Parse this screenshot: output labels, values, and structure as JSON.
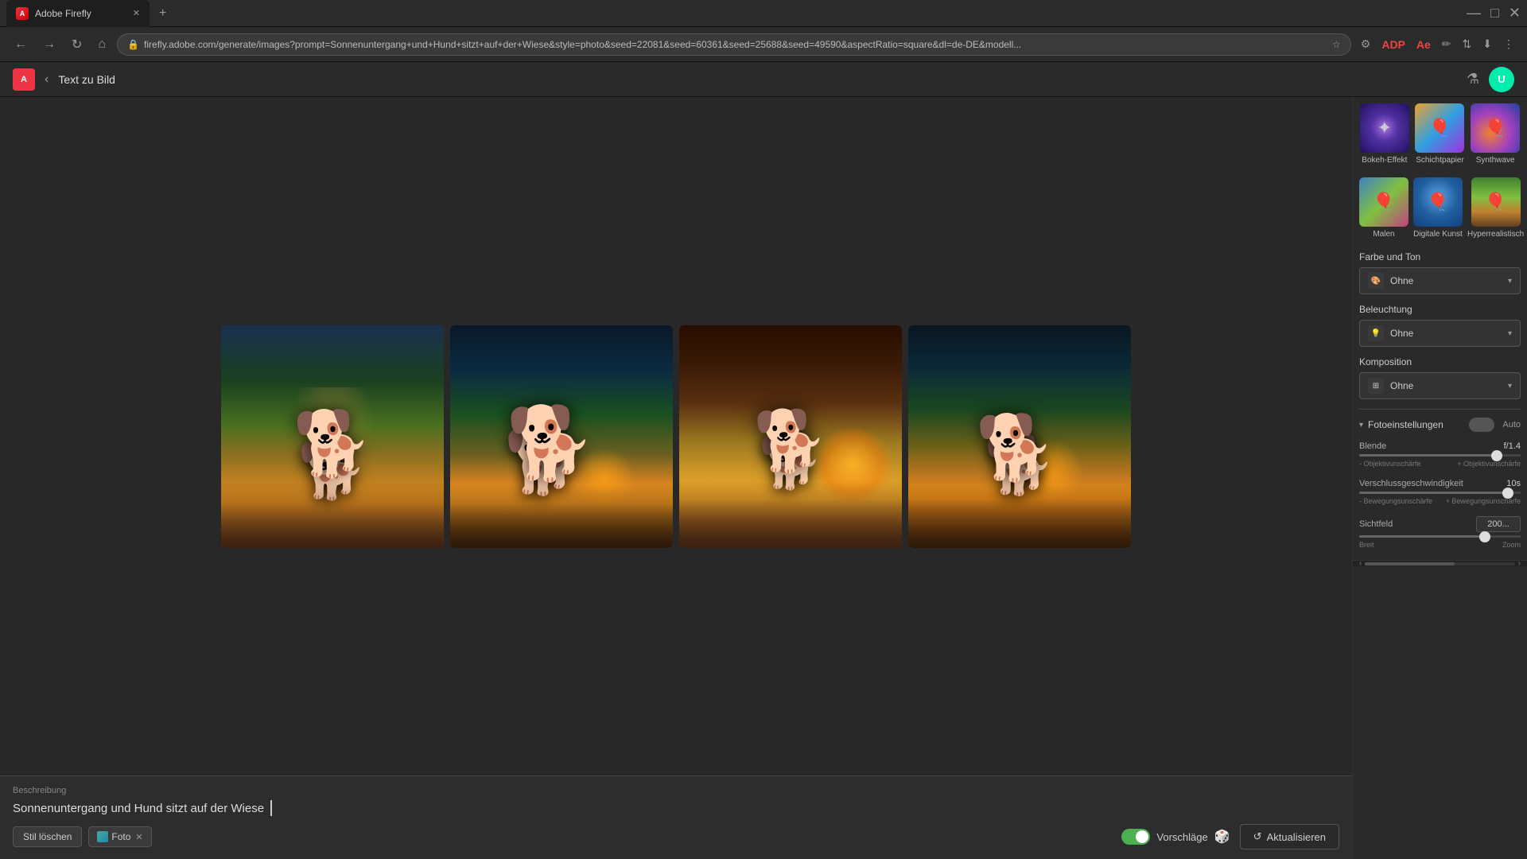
{
  "browser": {
    "tab_title": "Adobe Firefly",
    "url": "firefly.adobe.com/generate/images?prompt=Sonnenuntergang+und+Hund+sitzt+auf+der+Wiese&style=photo&seed=22081&seed=60361&seed=25688&seed=49590&aspectRatio=square&dl=de-DE&modell..."
  },
  "app": {
    "title": "Text zu Bild",
    "logo_text": "A"
  },
  "styles": {
    "row1": [
      {
        "id": "bokeh",
        "label": "Bokeh-Effekt"
      },
      {
        "id": "schicht",
        "label": "Schichtpapier"
      },
      {
        "id": "synth",
        "label": "Synthwave"
      }
    ],
    "row2": [
      {
        "id": "malen",
        "label": "Malen"
      },
      {
        "id": "digital",
        "label": "Digitale Kunst"
      },
      {
        "id": "hyper",
        "label": "Hyperrealistisch"
      }
    ]
  },
  "dropdowns": {
    "farbe_label": "Farbe und Ton",
    "farbe_value": "Ohne",
    "beleuchtung_label": "Beleuchtung",
    "beleuchtung_value": "Ohne",
    "komposition_label": "Komposition",
    "komposition_value": "Ohne"
  },
  "fotoeinstellungen": {
    "title": "Fotoeinstellungen",
    "auto_label": "Auto",
    "blende": {
      "label": "Blende",
      "value": "f/1.4",
      "left_label": "- Objektivunschärfe",
      "right_label": "+ Objektivunschärfe",
      "position": 85
    },
    "verschluss": {
      "label": "Verschlussgeschwindigkeit",
      "value": "10s",
      "left_label": "- Bewegungsunschärfe",
      "right_label": "+ Bewegungsunschärfe",
      "position": 92
    },
    "sichtfeld": {
      "label": "Sichtfeld",
      "value": "200...",
      "left_label": "Breit",
      "right_label": "Zoom",
      "position": 78
    }
  },
  "prompt": {
    "label": "Beschreibung",
    "text": "Sonnenuntergang und Hund sitzt auf der Wiese",
    "style_clear_label": "Stil löschen",
    "foto_tag": "Foto",
    "vorschlaege_label": "Vorschläge",
    "update_label": "Aktualisieren"
  }
}
